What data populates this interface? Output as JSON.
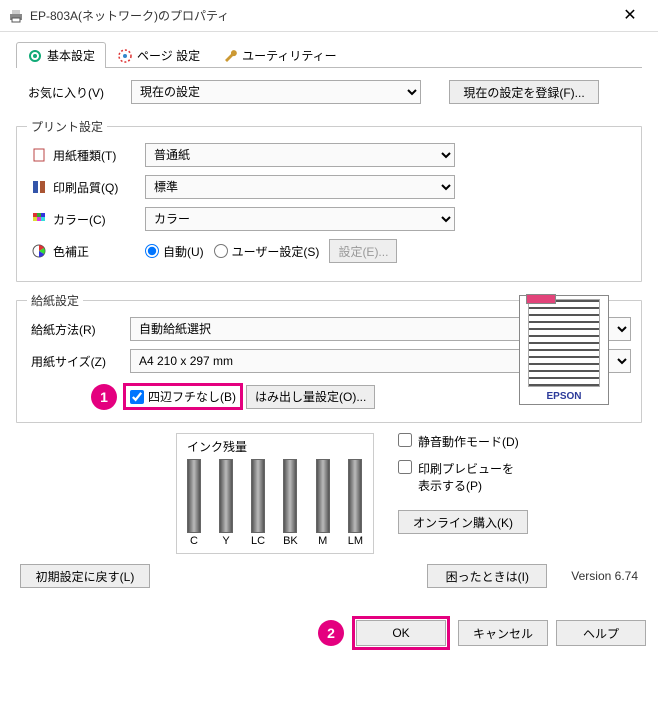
{
  "titlebar": {
    "title": "EP-803A(ネットワーク)のプロパティ"
  },
  "tabs": {
    "items": [
      {
        "label": "基本設定"
      },
      {
        "label": "ページ 設定"
      },
      {
        "label": "ユーティリティー"
      }
    ]
  },
  "favorite": {
    "label": "お気に入り(V)",
    "value": "現在の設定",
    "register_button": "現在の設定を登録(F)..."
  },
  "print_settings": {
    "legend": "プリント設定",
    "paper_type_label": "用紙種類(T)",
    "paper_type_value": "普通紙",
    "quality_label": "印刷品質(Q)",
    "quality_value": "標準",
    "color_label": "カラー(C)",
    "color_value": "カラー",
    "color_correction_label": "色補正",
    "auto_label": "自動(U)",
    "user_settings_label": "ユーザー設定(S)",
    "settings_button": "設定(E)...",
    "preview_logo": "EPSON"
  },
  "paper_settings": {
    "legend": "給紙設定",
    "method_label": "給紙方法(R)",
    "method_value": "自動給紙選択",
    "size_label": "用紙サイズ(Z)",
    "size_value": "A4 210 x 297 mm",
    "borderless_label": "四辺フチなし(B)",
    "extend_button": "はみ出し量設定(O)..."
  },
  "ink": {
    "title": "インク残量",
    "labels": [
      "C",
      "Y",
      "LC",
      "BK",
      "M",
      "LM"
    ]
  },
  "options": {
    "quiet_label": "静音動作モード(D)",
    "preview_label": "印刷プレビューを\n表示する(P)",
    "online_button": "オンライン購入(K)"
  },
  "bottom": {
    "reset_button": "初期設定に戻す(L)",
    "help_button": "困ったときは(I)",
    "version": "Version 6.74"
  },
  "dialog": {
    "ok": "OK",
    "cancel": "キャンセル",
    "help": "ヘルプ"
  },
  "callouts": {
    "one": "1",
    "two": "2"
  }
}
